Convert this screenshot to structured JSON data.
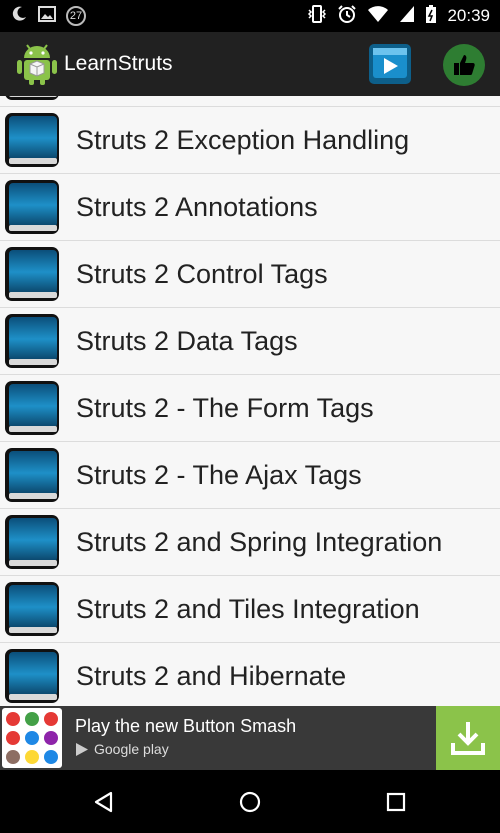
{
  "status_bar": {
    "notification_count": "27",
    "time": "20:39",
    "icons": [
      "snooze-icon",
      "image-icon",
      "vibrate-icon",
      "alarm-icon",
      "wifi-icon",
      "signal-icon",
      "battery-icon"
    ]
  },
  "action_bar": {
    "title": "LearnStruts",
    "actions": [
      "video-tutorial-icon",
      "thumbs-up-icon"
    ]
  },
  "list": {
    "items": [
      {
        "label": ""
      },
      {
        "label": "Struts 2 Exception Handling"
      },
      {
        "label": "Struts 2 Annotations"
      },
      {
        "label": "Struts 2 Control Tags"
      },
      {
        "label": "Struts 2 Data Tags"
      },
      {
        "label": "Struts 2 - The Form Tags"
      },
      {
        "label": "Struts 2 - The Ajax Tags"
      },
      {
        "label": "Struts 2 and Spring Integration"
      },
      {
        "label": "Struts 2 and Tiles Integration"
      },
      {
        "label": "Struts 2 and Hibernate"
      }
    ]
  },
  "ad": {
    "text": "Play the new Button Smash",
    "store": "Google play",
    "action_icon": "download-icon"
  },
  "nav_bar": [
    "back-icon",
    "home-icon",
    "recents-icon"
  ],
  "colors": {
    "action_bar": "#212121",
    "list_background": "#f7f7f7",
    "ad_background": "#393939",
    "download_button": "#8bc34a",
    "like_button": "#2e7d32"
  }
}
